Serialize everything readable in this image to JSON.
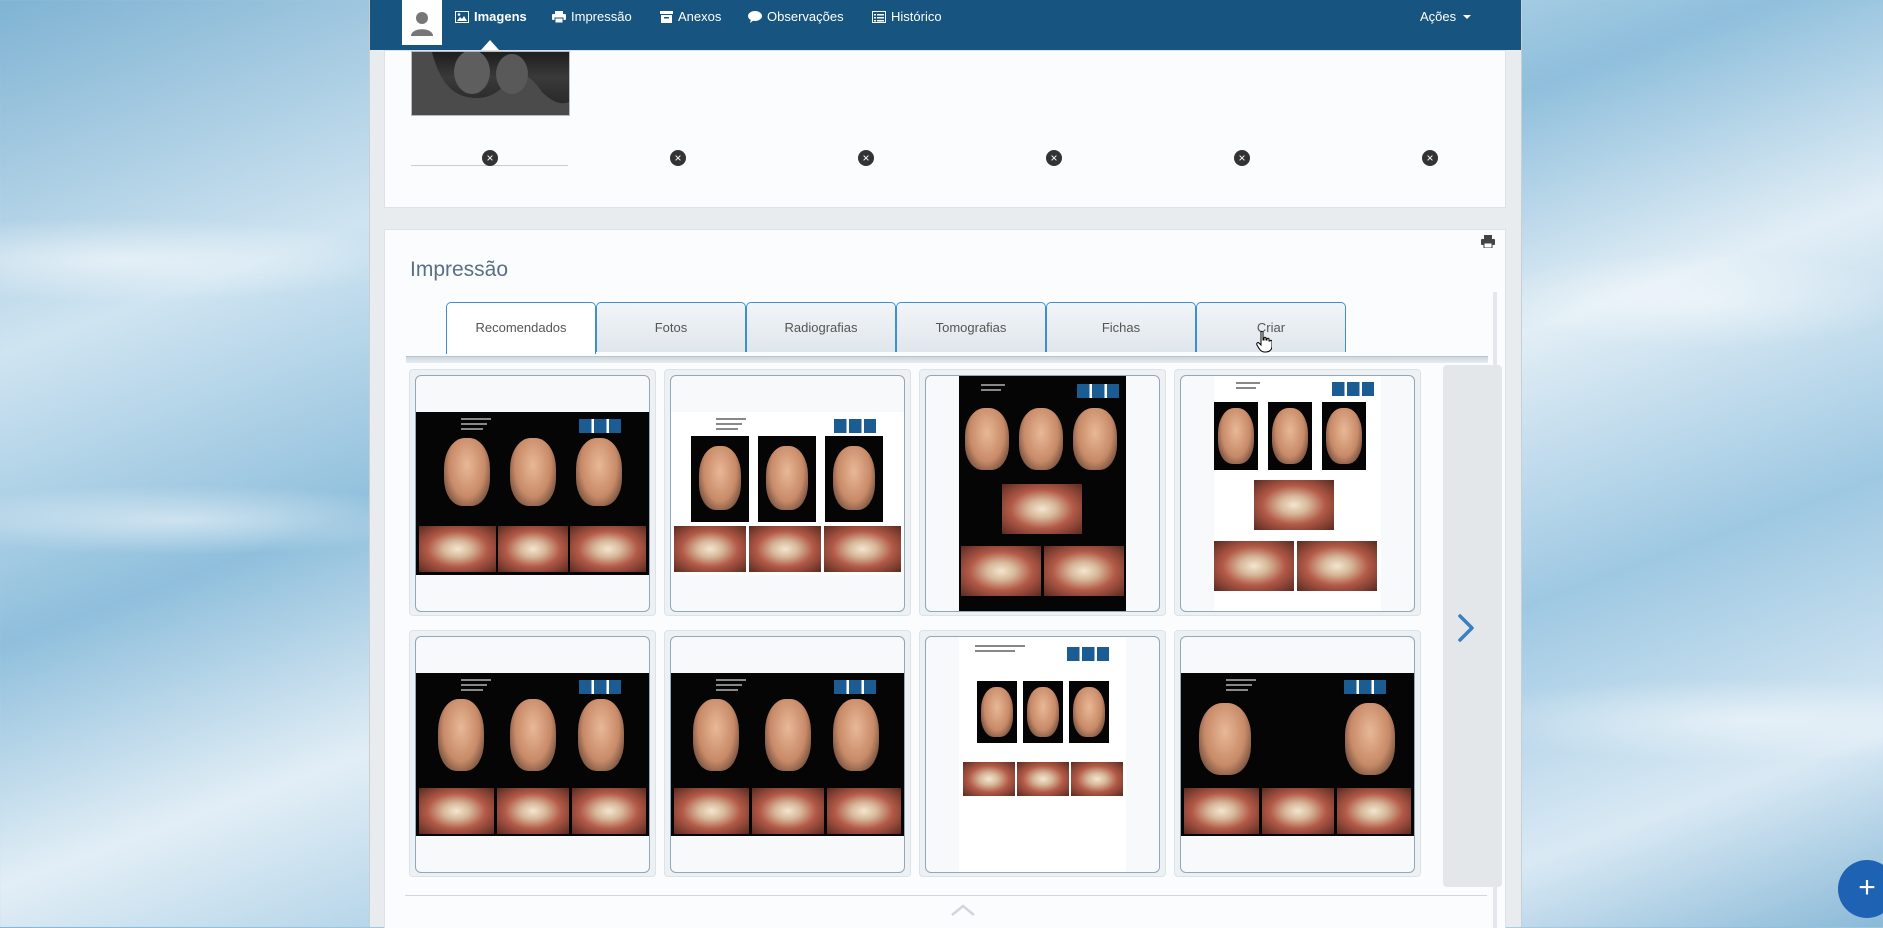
{
  "nav": {
    "items": [
      {
        "label": "Imagens",
        "icon": "image-icon"
      },
      {
        "label": "Impressão",
        "icon": "print-icon"
      },
      {
        "label": "Anexos",
        "icon": "archive-icon"
      },
      {
        "label": "Observações",
        "icon": "comment-icon"
      },
      {
        "label": "Histórico",
        "icon": "list-icon"
      }
    ],
    "actions_label": "Ações"
  },
  "print_section": {
    "title": "Impressão",
    "tabs": [
      "Recomendados",
      "Fotos",
      "Radiografias",
      "Tomografias",
      "Fichas",
      "Criar"
    ],
    "active_tab": "Recomendados"
  },
  "colors": {
    "nav_bg": "#17547f",
    "tab_border": "#3d8fcf",
    "fab": "#1d62b3"
  }
}
